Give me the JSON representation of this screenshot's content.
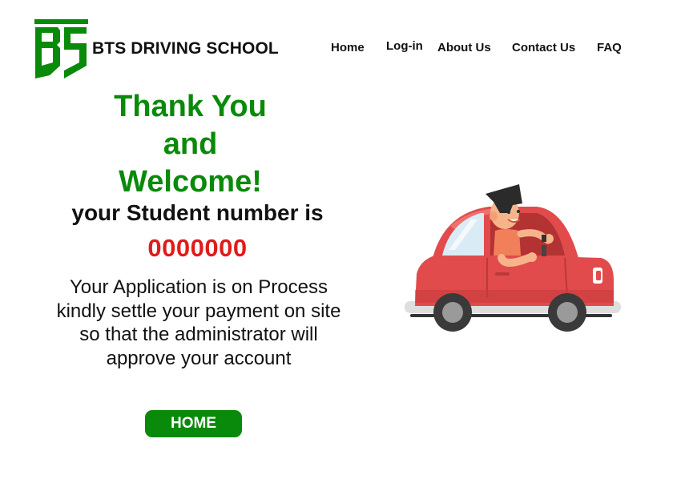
{
  "brand": {
    "name": "BTS DRIVING SCHOOL",
    "logo_icon": "bts-shield-logo",
    "color": "#0a8a0a"
  },
  "nav": {
    "items": [
      {
        "label": "Home"
      },
      {
        "label": "Log-in"
      },
      {
        "label": "About Us"
      },
      {
        "label": "Contact Us"
      },
      {
        "label": "FAQ"
      }
    ]
  },
  "main": {
    "headline": [
      "Thank You",
      "and",
      "Welcome!"
    ],
    "student_label": "your Student number is",
    "student_number": "0000000",
    "message": [
      "Your Application is on Process",
      "kindly settle your payment on site",
      "so that the administrator will",
      "approve your account"
    ],
    "home_button": "HOME"
  },
  "illustration": {
    "icon": "driver-in-red-car-illustration"
  },
  "colors": {
    "accent": "#0a8a0a",
    "number": "#e01b1b",
    "car": "#e14b4b"
  }
}
